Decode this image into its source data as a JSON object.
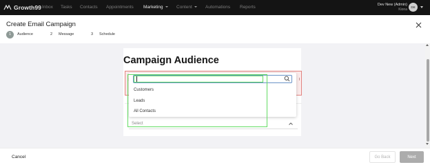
{
  "nav": {
    "brand": "Growth99",
    "items": [
      {
        "label": "Inbox"
      },
      {
        "label": "Tasks"
      },
      {
        "label": "Contacts"
      },
      {
        "label": "Appointments"
      },
      {
        "label": "Marketing"
      },
      {
        "label": "Content"
      },
      {
        "label": "Automations"
      },
      {
        "label": "Reports"
      }
    ],
    "user": {
      "name": "Dev New (Admin)",
      "subtitle": "Kiona",
      "avatar_initials": "DE"
    }
  },
  "header": {
    "title": "Create Email Campaign",
    "steps": [
      {
        "number": "1",
        "label": "Audience",
        "active": true
      },
      {
        "number": "2",
        "label": "Message",
        "active": false
      },
      {
        "number": "3",
        "label": "Schedule",
        "active": false
      }
    ]
  },
  "main": {
    "title": "Campaign Audience",
    "error_fragment_left": "t",
    "error_fragment_right": "l",
    "search": {
      "value": "",
      "placeholder": ""
    },
    "options": [
      {
        "label": "Customers"
      },
      {
        "label": "Leads"
      },
      {
        "label": "All Contacts"
      }
    ],
    "select_value": "Select"
  },
  "footer": {
    "cancel_label": "Cancel",
    "back_label": "Go Back",
    "next_label": "Next"
  },
  "colors": {
    "nav_bg": "#141414",
    "highlight": "#62dc62",
    "error_border": "#e2837f",
    "focus_border": "#6a93c7",
    "next_button": "#acacac"
  }
}
